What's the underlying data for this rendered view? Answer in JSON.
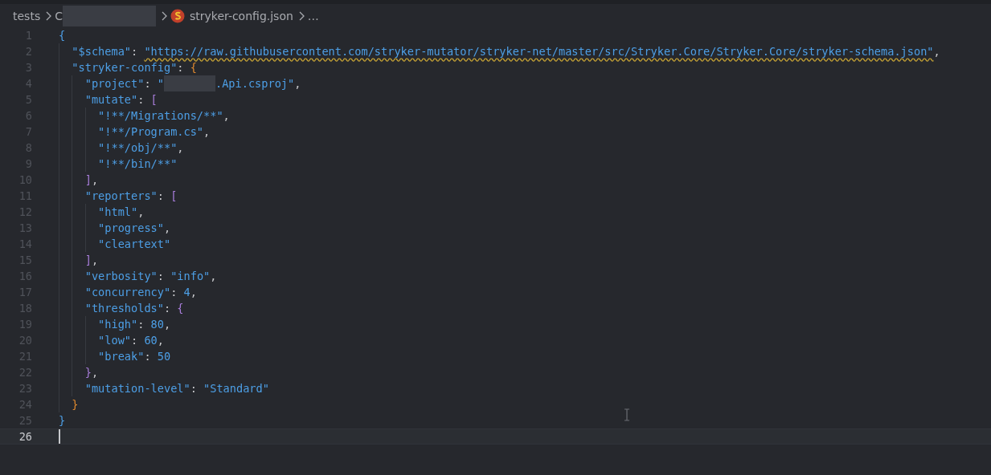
{
  "breadcrumb": [
    {
      "kind": "folder",
      "text": "tests",
      "redacted": false
    },
    {
      "kind": "folder",
      "text": "C",
      "redacted": true
    },
    {
      "kind": "file",
      "text": "stryker-config.json",
      "redacted": false
    },
    {
      "kind": "more",
      "text": "…",
      "redacted": false
    }
  ],
  "editor": {
    "lines": [
      {
        "number": "1",
        "current": false,
        "tokens": [
          {
            "kind": "bracket",
            "text": "{",
            "color": "#4d9fe6"
          }
        ]
      },
      {
        "number": "2",
        "current": false,
        "tokens": [
          {
            "kind": "key",
            "text": "  \"$schema\""
          },
          {
            "kind": "punct",
            "text": ": "
          },
          {
            "kind": "link",
            "text": "\"https://raw.githubusercontent.com/stryker-mutator/stryker-net/master/src/Stryker.Core/Stryker.Core/stryker-schema.json\""
          },
          {
            "kind": "punct",
            "text": ","
          }
        ]
      },
      {
        "number": "3",
        "current": false,
        "tokens": [
          {
            "kind": "key",
            "text": "  \"stryker-config\""
          },
          {
            "kind": "punct",
            "text": ": "
          },
          {
            "kind": "bracket",
            "text": "{",
            "color": "#e0892e"
          }
        ]
      },
      {
        "number": "4",
        "current": false,
        "tokens": [
          {
            "kind": "key",
            "text": "    \"project\""
          },
          {
            "kind": "punct",
            "text": ": "
          },
          {
            "kind": "string",
            "text": "\""
          },
          {
            "kind": "redacted"
          },
          {
            "kind": "string",
            "text": ".Api.csproj\""
          },
          {
            "kind": "punct",
            "text": ","
          }
        ]
      },
      {
        "number": "5",
        "current": false,
        "tokens": [
          {
            "kind": "key",
            "text": "    \"mutate\""
          },
          {
            "kind": "punct",
            "text": ": "
          },
          {
            "kind": "bracket",
            "text": "[",
            "color": "#a87ddb"
          }
        ]
      },
      {
        "number": "6",
        "current": false,
        "tokens": [
          {
            "kind": "string",
            "text": "      \"!**/Migrations/**\""
          },
          {
            "kind": "punct",
            "text": ","
          }
        ]
      },
      {
        "number": "7",
        "current": false,
        "tokens": [
          {
            "kind": "string",
            "text": "      \"!**/Program.cs\""
          },
          {
            "kind": "punct",
            "text": ","
          }
        ]
      },
      {
        "number": "8",
        "current": false,
        "tokens": [
          {
            "kind": "string",
            "text": "      \"!**/obj/**\""
          },
          {
            "kind": "punct",
            "text": ","
          }
        ]
      },
      {
        "number": "9",
        "current": false,
        "tokens": [
          {
            "kind": "string",
            "text": "      \"!**/bin/**\""
          }
        ]
      },
      {
        "number": "10",
        "current": false,
        "tokens": [
          {
            "kind": "bracket",
            "text": "    ]",
            "color": "#a87ddb"
          },
          {
            "kind": "punct",
            "text": ","
          }
        ]
      },
      {
        "number": "11",
        "current": false,
        "tokens": [
          {
            "kind": "key",
            "text": "    \"reporters\""
          },
          {
            "kind": "punct",
            "text": ": "
          },
          {
            "kind": "bracket",
            "text": "[",
            "color": "#a87ddb"
          }
        ]
      },
      {
        "number": "12",
        "current": false,
        "tokens": [
          {
            "kind": "string",
            "text": "      \"html\""
          },
          {
            "kind": "punct",
            "text": ","
          }
        ]
      },
      {
        "number": "13",
        "current": false,
        "tokens": [
          {
            "kind": "string",
            "text": "      \"progress\""
          },
          {
            "kind": "punct",
            "text": ","
          }
        ]
      },
      {
        "number": "14",
        "current": false,
        "tokens": [
          {
            "kind": "string",
            "text": "      \"cleartext\""
          }
        ]
      },
      {
        "number": "15",
        "current": false,
        "tokens": [
          {
            "kind": "bracket",
            "text": "    ]",
            "color": "#a87ddb"
          },
          {
            "kind": "punct",
            "text": ","
          }
        ]
      },
      {
        "number": "16",
        "current": false,
        "tokens": [
          {
            "kind": "key",
            "text": "    \"verbosity\""
          },
          {
            "kind": "punct",
            "text": ": "
          },
          {
            "kind": "string",
            "text": "\"info\""
          },
          {
            "kind": "punct",
            "text": ","
          }
        ]
      },
      {
        "number": "17",
        "current": false,
        "tokens": [
          {
            "kind": "key",
            "text": "    \"concurrency\""
          },
          {
            "kind": "punct",
            "text": ": "
          },
          {
            "kind": "number",
            "text": "4"
          },
          {
            "kind": "punct",
            "text": ","
          }
        ]
      },
      {
        "number": "18",
        "current": false,
        "tokens": [
          {
            "kind": "key",
            "text": "    \"thresholds\""
          },
          {
            "kind": "punct",
            "text": ": "
          },
          {
            "kind": "bracket",
            "text": "{",
            "color": "#a87ddb"
          }
        ]
      },
      {
        "number": "19",
        "current": false,
        "tokens": [
          {
            "kind": "key",
            "text": "      \"high\""
          },
          {
            "kind": "punct",
            "text": ": "
          },
          {
            "kind": "number",
            "text": "80"
          },
          {
            "kind": "punct",
            "text": ","
          }
        ]
      },
      {
        "number": "20",
        "current": false,
        "tokens": [
          {
            "kind": "key",
            "text": "      \"low\""
          },
          {
            "kind": "punct",
            "text": ": "
          },
          {
            "kind": "number",
            "text": "60"
          },
          {
            "kind": "punct",
            "text": ","
          }
        ]
      },
      {
        "number": "21",
        "current": false,
        "tokens": [
          {
            "kind": "key",
            "text": "      \"break\""
          },
          {
            "kind": "punct",
            "text": ": "
          },
          {
            "kind": "number",
            "text": "50"
          }
        ]
      },
      {
        "number": "22",
        "current": false,
        "tokens": [
          {
            "kind": "bracket",
            "text": "    }",
            "color": "#a87ddb"
          },
          {
            "kind": "punct",
            "text": ","
          }
        ]
      },
      {
        "number": "23",
        "current": false,
        "tokens": [
          {
            "kind": "key",
            "text": "    \"mutation-level\""
          },
          {
            "kind": "punct",
            "text": ": "
          },
          {
            "kind": "string",
            "text": "\"Standard\""
          }
        ]
      },
      {
        "number": "24",
        "current": false,
        "tokens": [
          {
            "kind": "bracket",
            "text": "  }",
            "color": "#e0892e"
          }
        ]
      },
      {
        "number": "25",
        "current": false,
        "tokens": [
          {
            "kind": "bracket",
            "text": "}",
            "color": "#4d9fe6"
          }
        ]
      },
      {
        "number": "26",
        "current": true
      }
    ]
  }
}
